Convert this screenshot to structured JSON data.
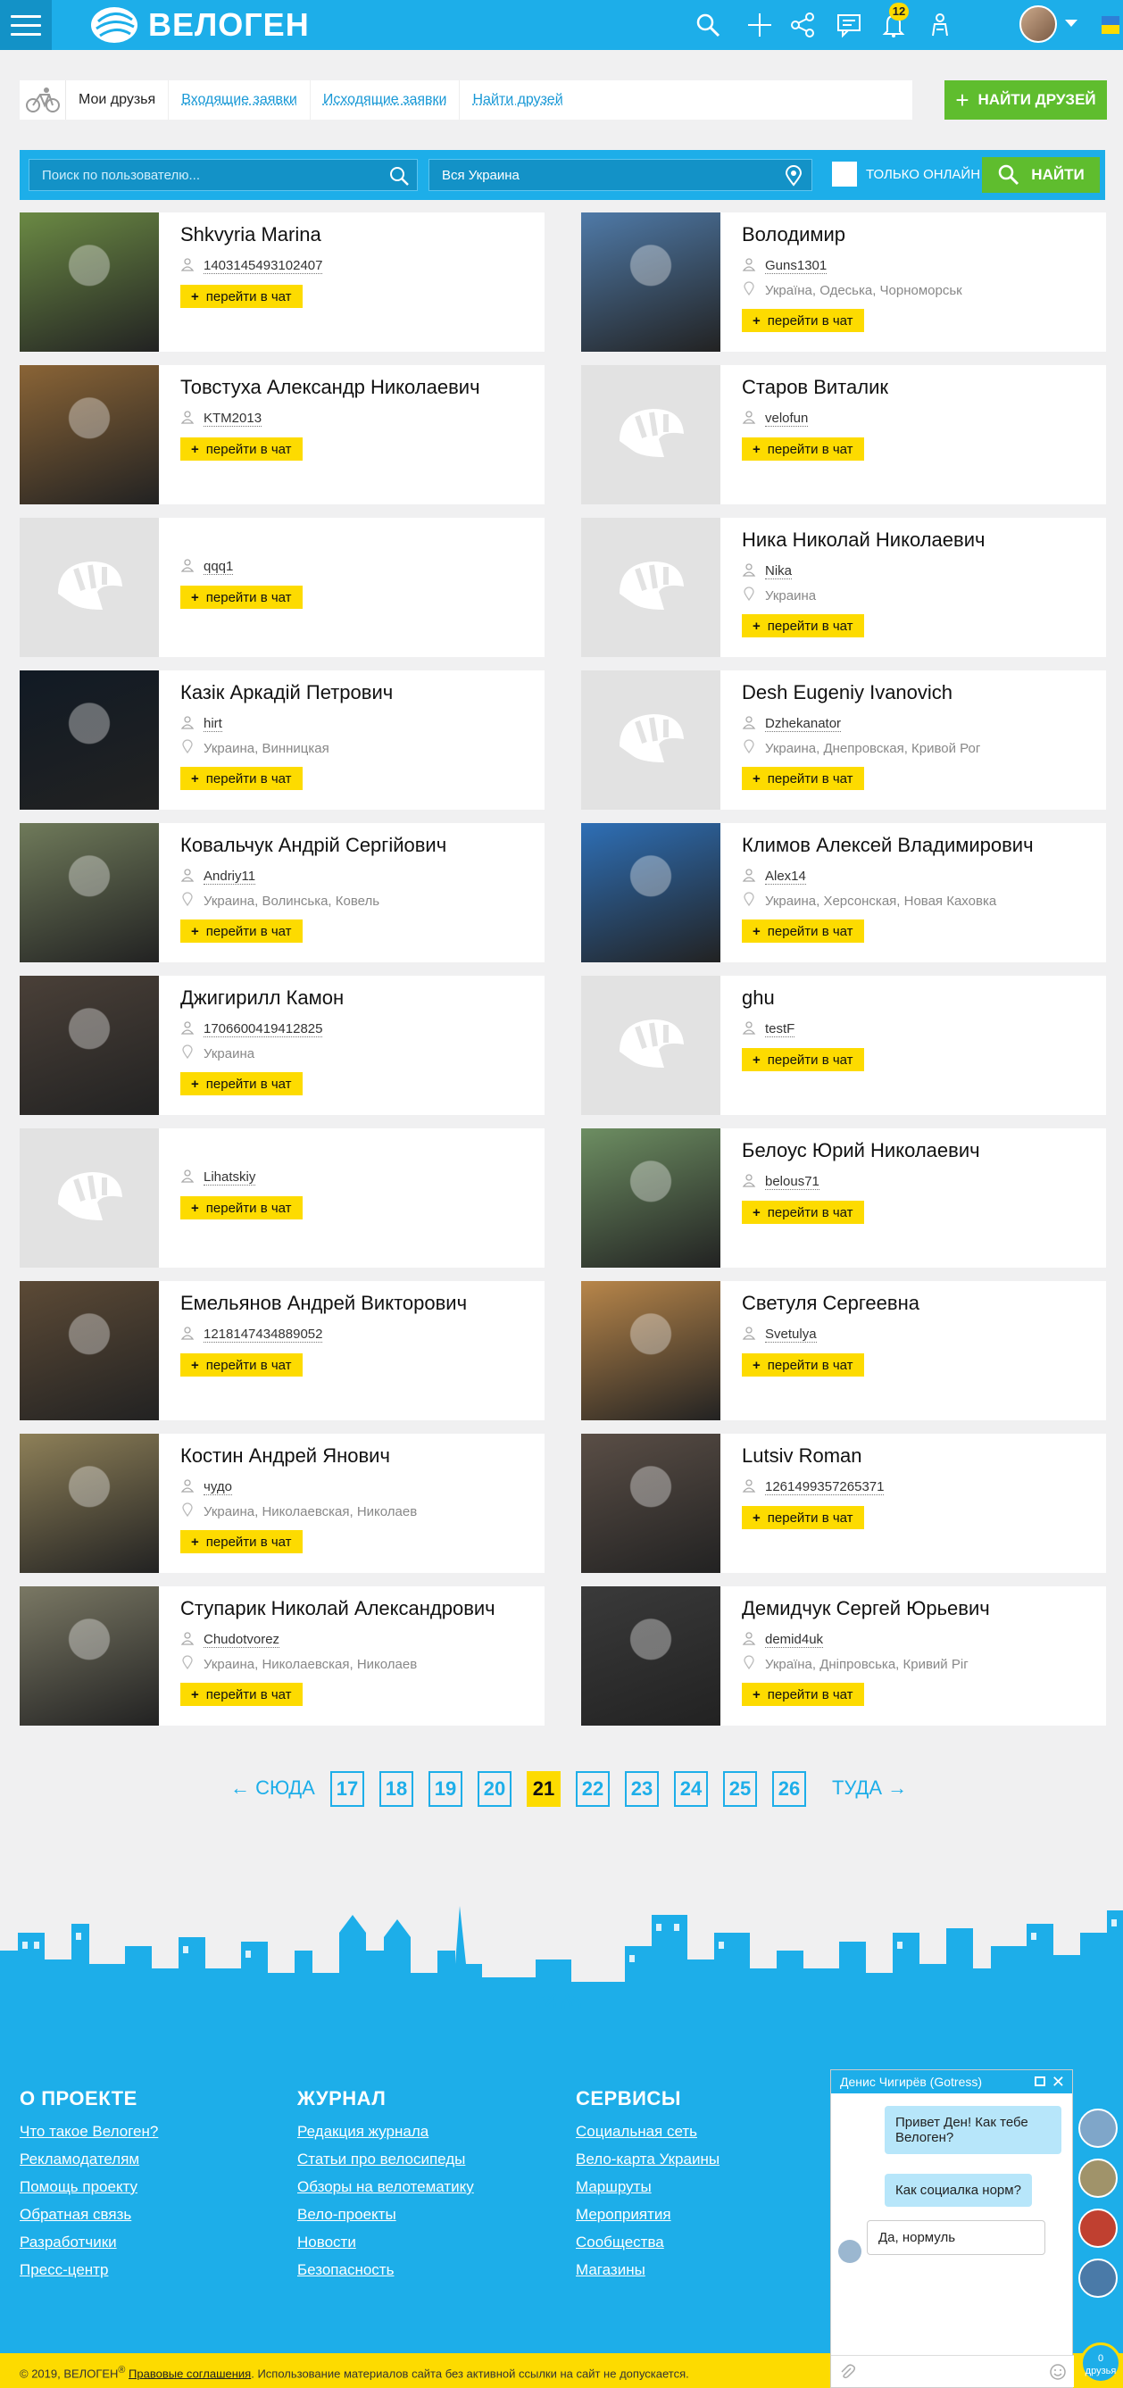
{
  "header": {
    "logo_text": "ВЕЛОГЕН",
    "notifications_count": "12",
    "icons": [
      "menu-icon",
      "search-icon",
      "plus-icon",
      "share-icon",
      "messages-icon",
      "bell-icon",
      "cyclist-icon"
    ]
  },
  "tabs": {
    "items": [
      {
        "label": "Мои друзья",
        "active": true
      },
      {
        "label": "Входящие заявки",
        "active": false
      },
      {
        "label": "Исходящие заявки",
        "active": false
      },
      {
        "label": "Найти друзей",
        "active": false
      }
    ],
    "find_button": "НАЙТИ ДРУЗЕЙ"
  },
  "search": {
    "user_placeholder": "Поиск по пользователю...",
    "region_value": "Вся Украина",
    "online_label": "ТОЛЬКО ОНЛАЙН",
    "go_button": "НАЙТИ"
  },
  "chat_button_label": "перейти в чат",
  "friends": [
    {
      "name": "Shkvyria Marina",
      "user": "1403145493102407",
      "location": "",
      "photo": "#6b8a44"
    },
    {
      "name": "Володимир",
      "user": "Guns1301",
      "location": "Україна, Одеська, Чорноморськ",
      "photo": "#4f7aa8"
    },
    {
      "name": "Товстуха Александр Николаевич",
      "user": "KTM2013",
      "location": "",
      "photo": "#8a6436"
    },
    {
      "name": "Старов Виталик",
      "user": "velofun",
      "location": "",
      "photo": ""
    },
    {
      "name": "",
      "user": "qqq1",
      "location": "",
      "photo": ""
    },
    {
      "name": "Ника Николай Николаевич",
      "user": "Nika",
      "location": "Украина",
      "photo": ""
    },
    {
      "name": "Казік Аркадій Петрович",
      "user": "hirt",
      "location": "Украина, Винницкая",
      "photo": "#111a24"
    },
    {
      "name": "Desh Eugeniy Ivanovich",
      "user": "Dzhekanator",
      "location": "Украина, Днепровская, Кривой Рог",
      "photo": ""
    },
    {
      "name": "Ковальчук Андрій Сергійович",
      "user": "Andriy11",
      "location": "Украина, Волинська, Ковель",
      "photo": "#6f7a5a"
    },
    {
      "name": "Климов Алексей Владимирович",
      "user": "Alex14",
      "location": "Украина, Херсонская, Новая Каховка",
      "photo": "#2e6fb6"
    },
    {
      "name": "Джигирилл Камон",
      "user": "1706600419412825",
      "location": "Украина",
      "photo": "#4a4038"
    },
    {
      "name": "ghu",
      "user": "testF",
      "location": "",
      "photo": ""
    },
    {
      "name": "",
      "user": "Lihatskiy",
      "location": "",
      "photo": ""
    },
    {
      "name": "Белоус Юрий Николаевич",
      "user": "belous71",
      "location": "",
      "photo": "#6d8e62"
    },
    {
      "name": "Емельянов Андрей Викторович",
      "user": "1218147434889052",
      "location": "",
      "photo": "#5c4a36"
    },
    {
      "name": "Светуля Сергеевна",
      "user": "Svetulya",
      "location": "",
      "photo": "#b8864a"
    },
    {
      "name": "Костин Андрей Янович",
      "user": "чудо",
      "location": "Украина, Николаевская, Николаев",
      "photo": "#8e8058"
    },
    {
      "name": "Lutsiv Roman",
      "user": "1261499357265371",
      "location": "",
      "photo": "#5a4e46"
    },
    {
      "name": "Ступарик Николай Александрович",
      "user": "Chudotvorez",
      "location": "Украина, Николаевская, Николаев",
      "photo": "#7a7864"
    },
    {
      "name": "Демидчук Сергей Юрьевич",
      "user": "demid4uk",
      "location": "Україна, Дніпровська, Кривий Ріг",
      "photo": "#3a3a3a"
    }
  ],
  "pagination": {
    "prev": "← СЮДА",
    "next": "ТУДА →",
    "pages": [
      "17",
      "18",
      "19",
      "20",
      "21",
      "22",
      "23",
      "24",
      "25",
      "26"
    ],
    "current": "21"
  },
  "footer": {
    "columns": [
      {
        "title": "О ПРОЕКТЕ",
        "links": [
          "Что такое Велоген?",
          "Рекламодателям",
          "Помощь проекту",
          "Обратная связь",
          "Разработчики",
          "Пресс-центр"
        ]
      },
      {
        "title": "ЖУРНАЛ",
        "links": [
          "Редакция журнала",
          "Статьи про велосипеды",
          "Обзоры на велотематику",
          "Вело-проекты",
          "Новости",
          "Безопасность"
        ]
      },
      {
        "title": "СЕРВИСЫ",
        "links": [
          "Социальная сеть",
          "Вело-карта Украины",
          "Маршруты",
          "Мероприятия",
          "Сообщества",
          "Магазины"
        ]
      }
    ],
    "copyright": "© 2019, ВЕЛОГЕН",
    "legal_link": "Правовые соглашения",
    "legal_text": ". Использование материалов сайта без активной ссылки на сайт не допускается."
  },
  "chat": {
    "title": "Денис Чигирёв (Gotress)",
    "messages": [
      {
        "text": "Привет Ден! Как тебе Велоген?",
        "from": "other"
      },
      {
        "text": "Как социалка норм?",
        "from": "other"
      },
      {
        "text": "Да, нормуль",
        "from": "me"
      }
    ],
    "friends_count": "0",
    "friends_label": "друзья"
  },
  "colors": {
    "brand_blue": "#1daee9",
    "accent_yellow": "#fddb00",
    "action_green": "#5fbd2e"
  }
}
